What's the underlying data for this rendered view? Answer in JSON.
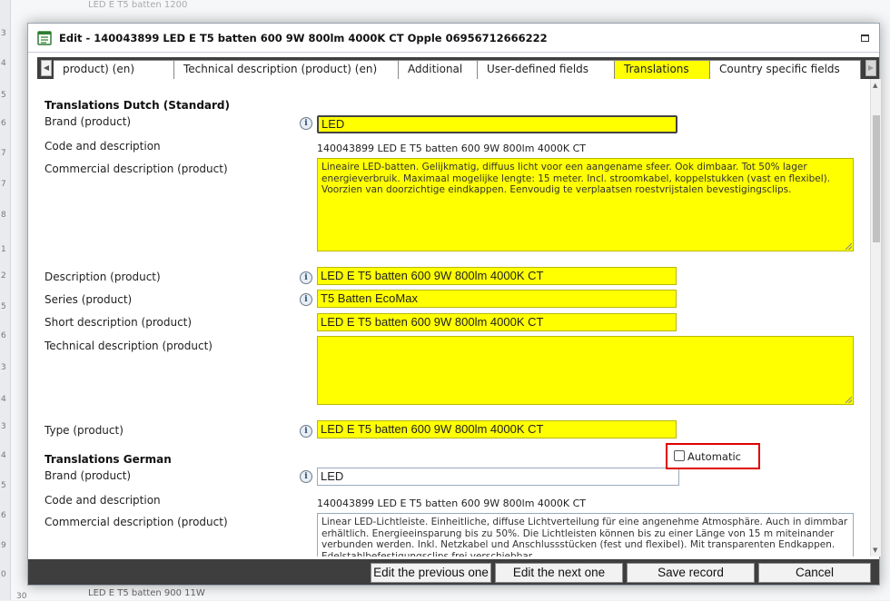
{
  "background": {
    "top_row_text": "LED E T5 batten 1200",
    "bottom_row_text": "LED E T5 batten 900 11W",
    "row_numbers": [
      "3",
      "4",
      "5",
      "6",
      "7",
      "7",
      "8",
      "1",
      "2",
      "5",
      "6",
      "3",
      "4",
      "3",
      "4",
      "5",
      "6",
      "9",
      "0",
      "30"
    ]
  },
  "dialog": {
    "title": "Edit - 140043899 LED E T5 batten 600 9W 800lm 4000K CT Opple 06956712666222",
    "tabs": [
      {
        "label": "product) (en)"
      },
      {
        "label": "Technical description (product) (en)"
      },
      {
        "label": "Additional"
      },
      {
        "label": "User-defined fields"
      },
      {
        "label": "Translations"
      },
      {
        "label": "Country specific fields"
      }
    ],
    "active_tab": "Translations",
    "accent_color": "#ffff00"
  },
  "dutch": {
    "section_title": "Translations Dutch (Standard)",
    "brand_label": "Brand (product)",
    "brand_value": "LED",
    "code_label": "Code and description",
    "code_value": "140043899 LED E T5 batten 600  9W 800lm 4000K  CT",
    "commercial_label": "Commercial description (product)",
    "commercial_value": "Lineaire LED-batten. Gelijkmatig, diffuus licht voor een aangename sfeer. Ook dimbaar. Tot 50% lager energieverbruik. Maximaal mogelijke lengte: 15 meter. Incl. stroomkabel, koppelstukken (vast en flexibel). Voorzien van doorzichtige eindkappen. Eenvoudig te verplaatsen roestvrijstalen bevestigingsclips.",
    "description_label": "Description (product)",
    "description_value": "LED E T5 batten 600  9W 800lm 4000K  CT",
    "series_label": "Series (product)",
    "series_value": "T5 Batten EcoMax",
    "short_label": "Short description (product)",
    "short_value": "LED E T5 batten 600  9W 800lm 4000K  CT",
    "technical_label": "Technical description (product)",
    "technical_value": "",
    "type_label": "Type (product)",
    "type_value": "LED E T5 batten 600  9W 800lm 4000K  CT"
  },
  "german": {
    "section_title": "Translations German",
    "brand_label": "Brand (product)",
    "brand_value": "LED",
    "automatic_label": "Automatic",
    "automatic_checked": false,
    "code_label": "Code and description",
    "code_value": "140043899 LED E T5 batten 600  9W 800lm 4000K  CT",
    "commercial_label": "Commercial description (product)",
    "commercial_value": "Linear LED-Lichtleiste. Einheitliche, diffuse Lichtverteilung für eine angenehme Atmosphäre. Auch in dimmbar erhältlich. Energieeinsparung bis zu 50%. Die Lichtleisten können bis zu einer Länge von 15 m miteinander verbunden werden. Inkl. Netzkabel und Anschlussstücken (fest und flexibel). Mit transparenten Endkappen. Edelstahlbefestigungsclips frei verschiebbar."
  },
  "buttons": {
    "previous": "Edit the previous one",
    "next": "Edit the next one",
    "save": "Save record",
    "cancel": "Cancel"
  }
}
